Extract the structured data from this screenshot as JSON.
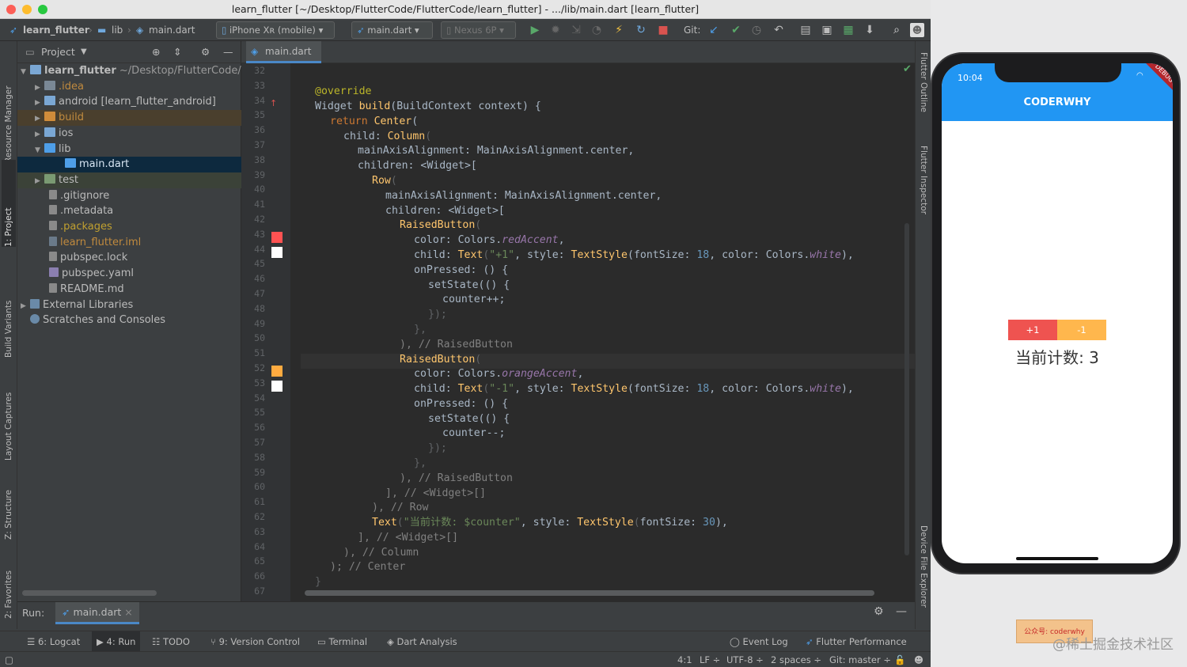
{
  "window": {
    "title": "learn_flutter [~/Desktop/FlutterCode/FlutterCode/learn_flutter] - .../lib/main.dart [learn_flutter]"
  },
  "nav": {
    "project": "learn_flutter",
    "lib": "lib",
    "file": "main.dart",
    "device": "iPhone Xʀ (mobile)",
    "config": "main.dart",
    "avd": "Nexus 6P",
    "git": "Git:"
  },
  "left_tabs": [
    "Resource Manager",
    "1: Project",
    "Build Variants",
    "Layout Captures",
    "Z: Structure",
    "2: Favorites"
  ],
  "right_tabs": [
    "Flutter Outline",
    "Flutter Inspector",
    "Device File Explorer"
  ],
  "project": {
    "header": "Project",
    "root_name": "learn_flutter",
    "root_path": "~/Desktop/FlutterCode/",
    "items": [
      {
        "label": ".idea"
      },
      {
        "label": "android [learn_flutter_android]"
      },
      {
        "label": "build"
      },
      {
        "label": "ios"
      },
      {
        "label": "lib"
      },
      {
        "label": "main.dart"
      },
      {
        "label": "test"
      },
      {
        "label": ".gitignore"
      },
      {
        "label": ".metadata"
      },
      {
        "label": ".packages"
      },
      {
        "label": "learn_flutter.iml"
      },
      {
        "label": "pubspec.lock"
      },
      {
        "label": "pubspec.yaml"
      },
      {
        "label": "README.md"
      },
      {
        "label": "External Libraries"
      },
      {
        "label": "Scratches and Consoles"
      }
    ]
  },
  "editor": {
    "tab": "main.dart",
    "line_numbers": [
      "32",
      "33",
      "34",
      "35",
      "36",
      "37",
      "38",
      "39",
      "40",
      "41",
      "42",
      "43",
      "44",
      "45",
      "46",
      "47",
      "48",
      "49",
      "50",
      "51",
      "52",
      "53",
      "54",
      "55",
      "56",
      "57",
      "58",
      "59",
      "60",
      "61",
      "62",
      "63",
      "64",
      "65",
      "66",
      "67"
    ],
    "c": {
      "override": "@override",
      "widget": "Widget ",
      "build": "build",
      "ctx": "(BuildContext context) {",
      "return": "return ",
      "center": "Center",
      "paren": "(",
      "child_col_a": "child: ",
      "column": "Column",
      "mainaxis": "mainAxisAlignment: MainAxisAlignment.center,",
      "children": "children: <Widget>[",
      "row": "Row",
      "raised": "RaisedButton",
      "color": "color: Colors.",
      "redAccent": "redAccent",
      "orangeAccent": "orangeAccent",
      "comma": ",",
      "child": "child: ",
      "text": "Text",
      "plus1": "\"+1\"",
      "minus1": "\"-1\"",
      "style": ", style: ",
      "textstyle": "TextStyle",
      "fs": "(fontSize: ",
      "n18": "18",
      "colorw": ", color: Colors.",
      "white": "white",
      "close": "),",
      "onpressed": "onPressed: () {",
      "setstate": "setState(() {",
      "counterpp": "counter++;",
      "counterMM": "counter--;",
      "close_set": "});",
      "close_brace": "},",
      "close_raised": "), // RaisedButton",
      "close_list": "], // <Widget>[]",
      "close_row": "), // Row",
      "textcount_str": "\"当前计数: $counter\"",
      "n30": "30",
      "close_list2": "], // <Widget>[]",
      "close_col": "), // Column",
      "close_center": "); // Center",
      "close_fn": "}"
    }
  },
  "run": {
    "label": "Run:",
    "config": "main.dart"
  },
  "bottom": {
    "logcat": "6: Logcat",
    "run": "4: Run",
    "todo": "TODO",
    "vcs": "9: Version Control",
    "terminal": "Terminal",
    "dart": "Dart Analysis",
    "event": "Event Log",
    "perf": "Flutter Performance"
  },
  "status": {
    "pos": "4:1",
    "lf": "LF ÷",
    "enc": "UTF-8 ÷",
    "indent": "2 spaces ÷",
    "git": "Git: master ÷"
  },
  "phone": {
    "time": "10:04",
    "title": "CODERWHY",
    "btn_plus": "+1",
    "btn_minus": "-1",
    "counter_text": "当前计数: 3",
    "debug": "DEBUG"
  },
  "watermark": {
    "badge": "公众号: coderwhy",
    "site": "@稀土掘金技术社区"
  },
  "colors": {
    "red": "#ef5350",
    "orange": "#ffb74d",
    "blue": "#2196f3"
  }
}
